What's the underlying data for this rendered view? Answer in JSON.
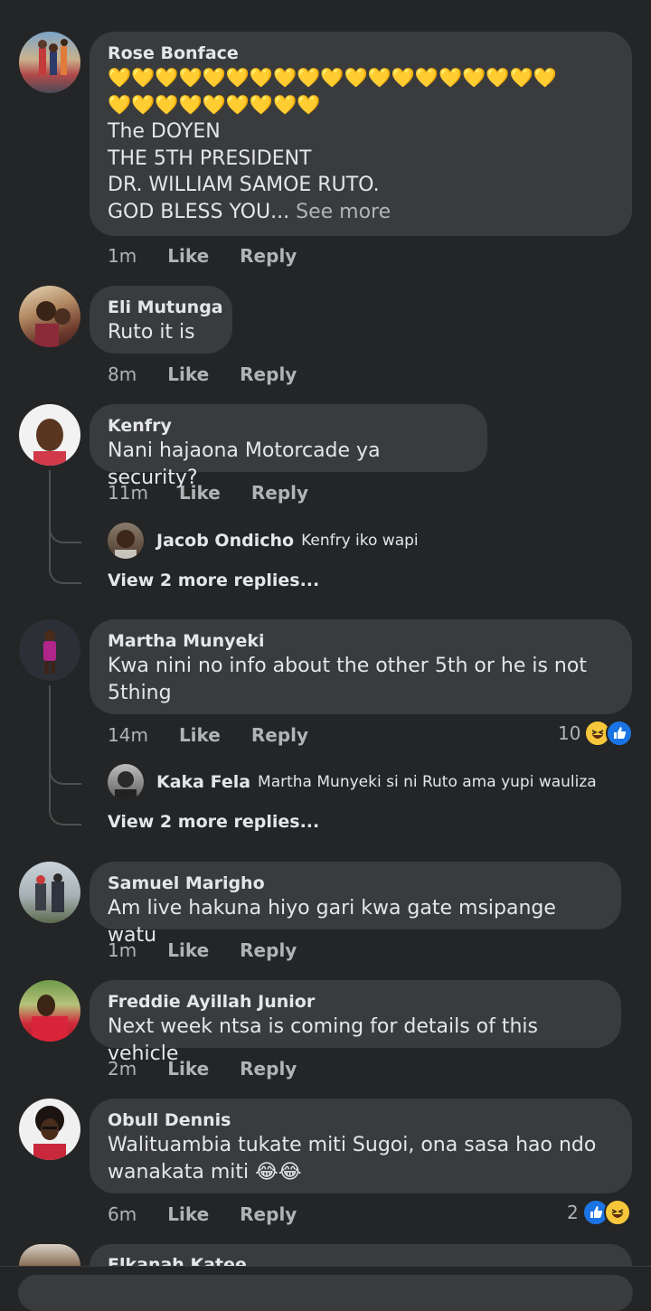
{
  "comments": [
    {
      "author": "Rose Bonface",
      "hearts_line1": "💛💛💛💛💛💛💛💛💛💛💛💛💛💛💛💛💛💛💛",
      "hearts_line2": "💛💛💛💛💛💛💛💛💛",
      "text": "The DOYEN\nTHE 5TH PRESIDENT\nDR. WILLIAM SAMOE RUTO.\nGOD BLESS YOU...",
      "see_more": "See more",
      "time": "1m",
      "like": "Like",
      "reply": "Reply"
    },
    {
      "author": "Eli Mutunga",
      "text": "Ruto it is",
      "time": "8m",
      "like": "Like",
      "reply": "Reply"
    },
    {
      "author": "Kenfry",
      "text": "Nani hajaona Motorcade ya security?",
      "time": "11m",
      "like": "Like",
      "reply": "Reply",
      "reply_preview": {
        "author": "Jacob Ondicho",
        "text": "Kenfry iko wapi"
      },
      "view_more": "View 2 more replies..."
    },
    {
      "author": "Martha Munyeki",
      "text": "Kwa nini no info about the other 5th or he is not\n5thing",
      "time": "14m",
      "like": "Like",
      "reply": "Reply",
      "reaction_count": "10",
      "reply_preview": {
        "author": "Kaka Fela",
        "text": "Martha Munyeki si ni Ruto ama yupi wauliza"
      },
      "view_more": "View 2 more replies..."
    },
    {
      "author": "Samuel Marigho",
      "text": "Am live hakuna hiyo gari kwa gate msipange watu",
      "time": "1m",
      "like": "Like",
      "reply": "Reply"
    },
    {
      "author": "Freddie Ayillah Junior",
      "text": "Next week ntsa is coming for details of this vehicle",
      "time": "2m",
      "like": "Like",
      "reply": "Reply"
    },
    {
      "author": "Obull Dennis",
      "text": "Walituambia tukate miti Sugoi, ona sasa hao ndo\nwanakata miti 😂😂",
      "time": "6m",
      "like": "Like",
      "reply": "Reply",
      "reaction_count": "2"
    },
    {
      "author": "Elkanah Katee"
    }
  ],
  "icons": {
    "like_reaction": "thumbs-up-icon",
    "haha_reaction": "laughing-face-icon"
  },
  "colors": {
    "background": "#242526",
    "bubble": "#3a3b3c",
    "like_blue": "#1b74e4",
    "haha_yellow": "#f7c73b"
  }
}
